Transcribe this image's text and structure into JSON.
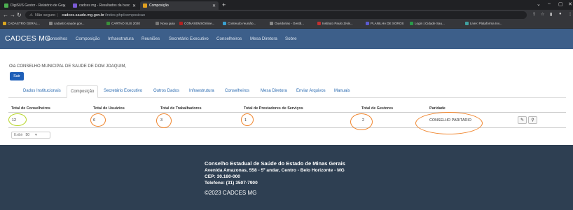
{
  "browser": {
    "tabs": [
      {
        "title": "DigiSUS Gestor - Relatório de Ge",
        "icon_color": "#4caf50"
      },
      {
        "title": "cadces mg - Resultados da busc",
        "icon_color": "#7b5bd6"
      },
      {
        "title": "Composição",
        "icon_color": "#e0a020"
      }
    ],
    "address": {
      "security": "Não seguro",
      "host": "cadces.saude.mg.gov.br",
      "path": "/index.php/composicao"
    },
    "bookmarks": [
      {
        "label": "CADASTRO GERAL...",
        "color": "#d9a520"
      },
      {
        "label": "cadastro.saude.gov...",
        "color": "#888888"
      },
      {
        "label": "CARTAO SUS 2020",
        "color": "#3a8f3a"
      },
      {
        "label": "Nova guia",
        "color": "#777777"
      },
      {
        "label": "CONASEMSOnline...",
        "color": "#b22222"
      },
      {
        "label": "Conteudo reunião...",
        "color": "#3aa0d0"
      },
      {
        "label": "Ouvidorias - Gestã...",
        "color": "#888888"
      },
      {
        "label": "Instituto Paulo Zivik...",
        "color": "#c03030"
      },
      {
        "label": "PLANILHA DE SOROS",
        "color": "#5a5ad0"
      },
      {
        "label": "Login | Cidade Sau...",
        "color": "#2a9a4a"
      },
      {
        "label": "Livre: Plataforma Inv...",
        "color": "#40a0a0"
      }
    ]
  },
  "app": {
    "brand": "CADCES MG",
    "nav": [
      "Conselhos",
      "Composição",
      "Infraestrutura",
      "Reuniões",
      "Secretário Executivo",
      "Conselheiros",
      "Mesa Diretora",
      "Sobre"
    ]
  },
  "greeting": "Olá CONSELHO MUNICIPAL DE SAUDE DE DOM JOAQUIM,",
  "logout_label": "Sair",
  "content_tabs": [
    "Dados Institucionais",
    "Composição",
    "Secretário Executivo",
    "Outros Dados",
    "Infraestrutura",
    "Conselheiros",
    "Mesa Diretora",
    "Enviar Arquivos",
    "Manuais"
  ],
  "active_tab_index": 1,
  "table": {
    "headers": [
      "Total de Conselheiros",
      "Total de Usuários",
      "Total de Trabalhadores",
      "Total de Prestadores de Serviços",
      "Total de Gestores",
      "Paridade"
    ],
    "row": [
      "12",
      "6",
      "3",
      "1",
      "2",
      "CONSELHO PARITARIO"
    ]
  },
  "actions": {
    "edit_icon": "edit-icon",
    "search_icon": "search-icon"
  },
  "pager": {
    "label": "Exibir",
    "value": "50"
  },
  "footer": {
    "title": "Conselho Estadual de Saúde do Estado de Minas Gerais",
    "address": "Avenida Amazonas, 558 - 5º andar, Centro - Belo Horizonte - MG",
    "cep": "CEP: 30.180-000",
    "phone": "Telefone: (31) 3507-7900",
    "copyright": "©2023 CADCES MG"
  },
  "colors": {
    "navbar": "#3d5f8a",
    "footer": "#2e3f52",
    "annotation_orange": "#f0852d",
    "annotation_green": "#b7d62a",
    "link": "#2a6ab0"
  }
}
